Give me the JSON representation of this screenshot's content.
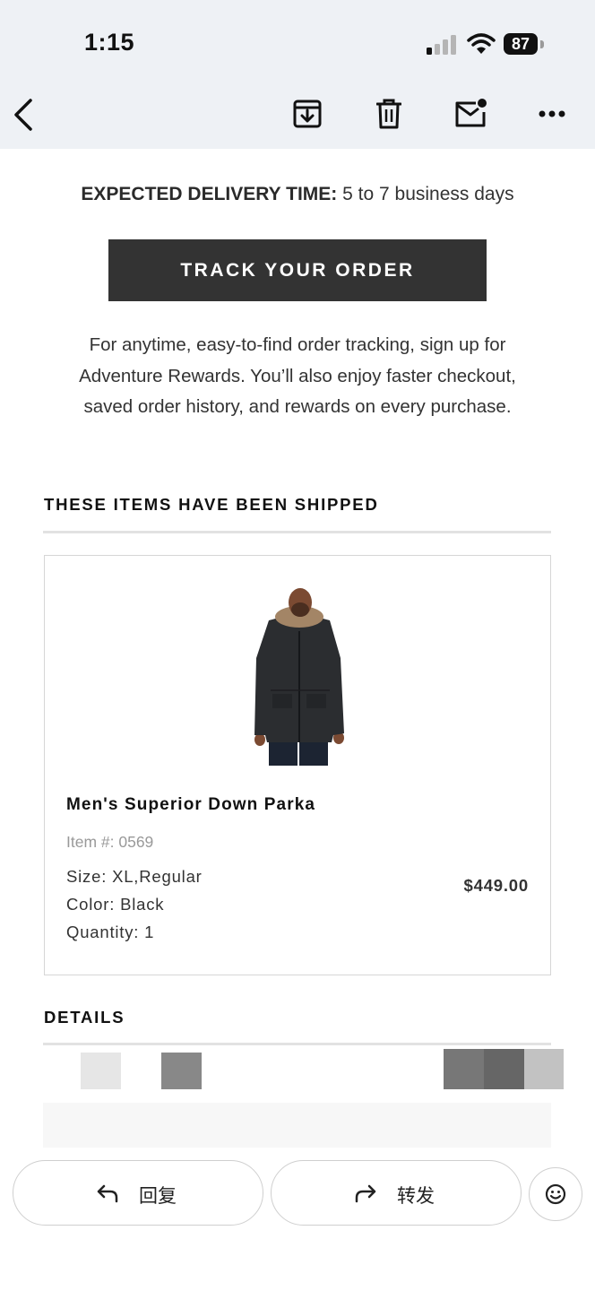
{
  "status_bar": {
    "time": "1:15",
    "battery": "87"
  },
  "email_toolbar": {
    "icons": [
      "back-icon",
      "archive-icon",
      "trash-icon",
      "mark-unread-icon",
      "more-icon"
    ]
  },
  "delivery": {
    "label": "EXPECTED DELIVERY TIME:",
    "value": "5 to 7 business days"
  },
  "track_button": "TRACK YOUR ORDER",
  "promo_lines": [
    "For anytime, easy-to-find order tracking, sign up for",
    "Adventure Rewards. You’ll also enjoy faster checkout,",
    "saved order history, and rewards on every purchase."
  ],
  "shipped_section": {
    "title": "THESE ITEMS HAVE BEEN SHIPPED"
  },
  "item": {
    "name": "Men's Superior Down Parka",
    "number": "Item #: 0569",
    "size": "Size: XL,Regular",
    "color": "Color: Black",
    "quantity": "Quantity: 1",
    "price": "$449.00"
  },
  "details_section": {
    "title": "DETAILS"
  },
  "bottom_actions": {
    "reply": "回复",
    "forward": "转发"
  },
  "colors": {
    "toolbar_bg": "#eef1f5",
    "button_dark": "#333333"
  }
}
